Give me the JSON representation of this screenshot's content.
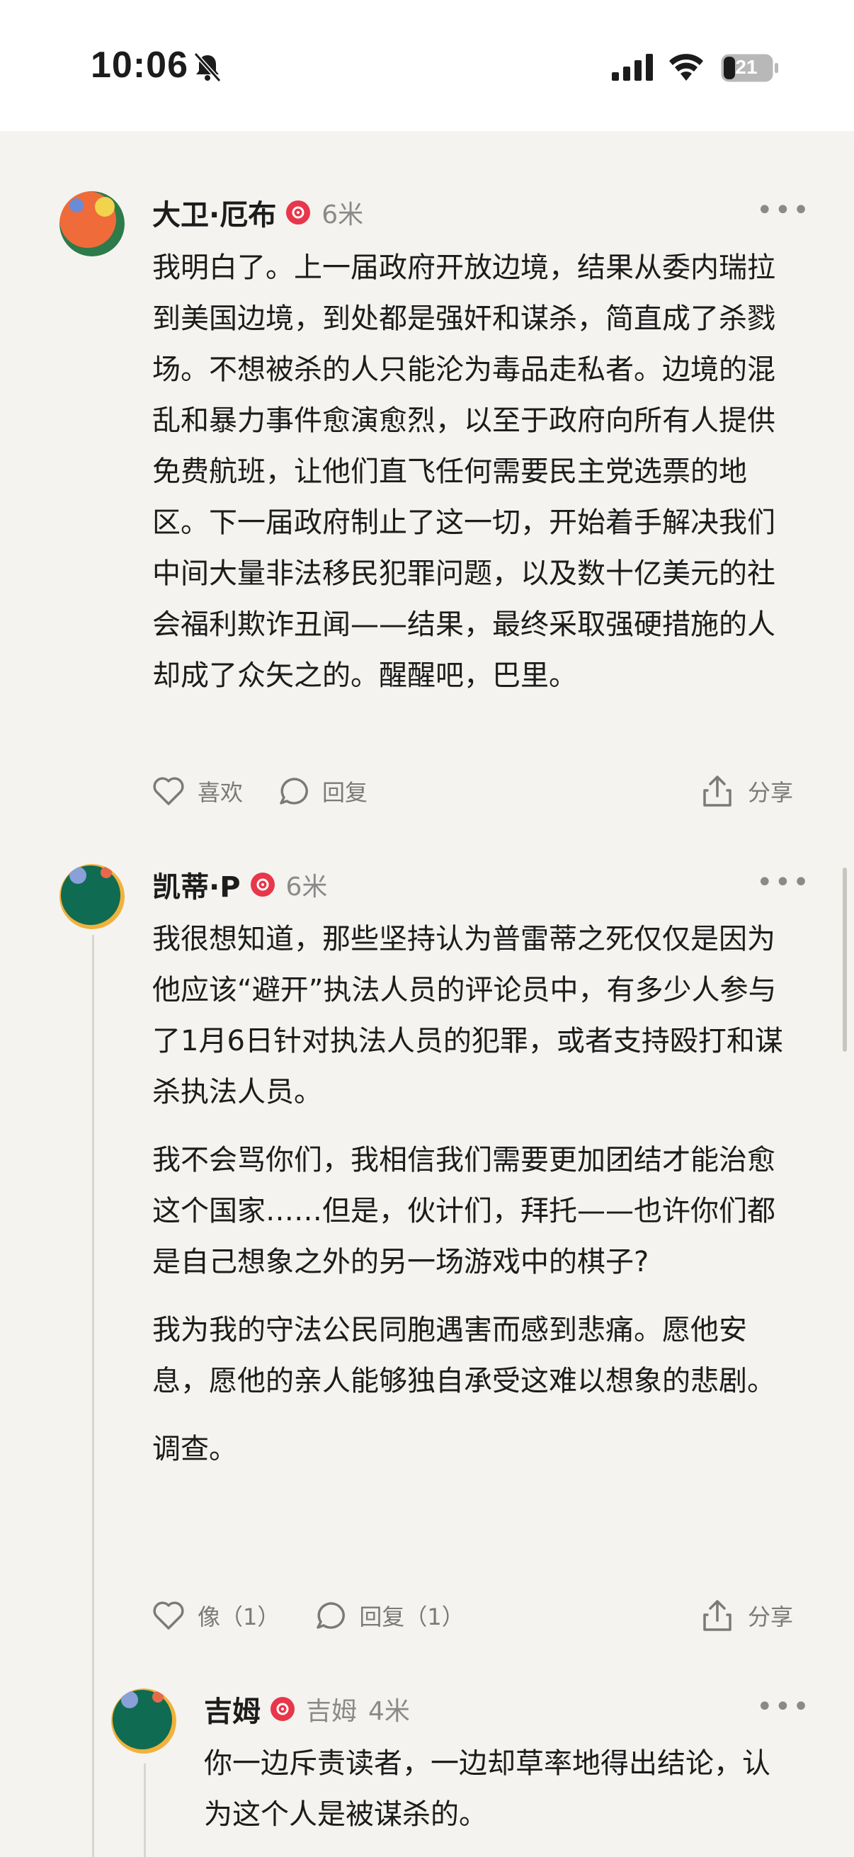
{
  "status": {
    "time": "10:06",
    "battery": "21"
  },
  "comments": [
    {
      "name": "大卫·厄布",
      "meta": "6米",
      "paragraphs": [
        "我明白了。上一届政府开放边境，结果从委内瑞拉到美国边境，到处都是强奸和谋杀，简直成了杀戮场。不想被杀的人只能沦为毒品走私者。边境的混乱和暴力事件愈演愈烈，以至于政府向所有人提供免费航班，让他们直飞任何需要民主党选票的地区。下一届政府制止了这一切，开始着手解决我们中间大量非法移民犯罪问题，以及数十亿美元的社会福利欺诈丑闻——结果，最终采取强硬措施的人却成了众矢之的。醒醒吧，巴里。"
      ],
      "like_label": "喜欢",
      "reply_label": "回复",
      "share_label": "分享"
    },
    {
      "name": "凯蒂·P",
      "meta": "6米",
      "paragraphs": [
        "我很想知道，那些坚持认为普雷蒂之死仅仅是因为他应该“避开”执法人员的评论员中，有多少人参与了1月6日针对执法人员的犯罪，或者支持殴打和谋杀执法人员。",
        "我不会骂你们，我相信我们需要更加团结才能治愈这个国家……但是，伙计们，拜托——也许你们都是自己想象之外的另一场游戏中的棋子?",
        "我为我的守法公民同胞遇害而感到悲痛。愿他安息，愿他的亲人能够独自承受这难以想象的悲剧。",
        "调查。"
      ],
      "like_label": "像（1）",
      "reply_label": "回复（1）",
      "share_label": "分享"
    },
    {
      "name": "吉姆",
      "handle": "吉姆",
      "meta": "4米",
      "paragraphs": [
        "你一边斥责读者，一边却草率地得出结论，认为这个人是被谋杀的。"
      ]
    }
  ]
}
